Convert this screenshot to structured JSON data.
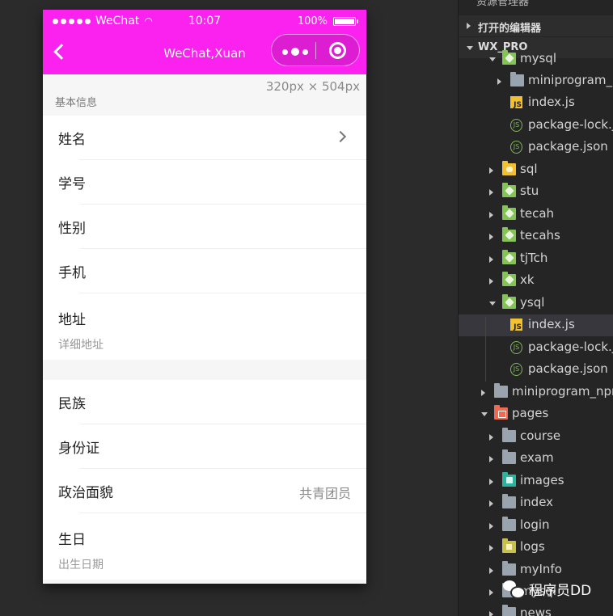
{
  "statusbar": {
    "carrier": "WeChat",
    "time": "10:07",
    "battery": "100%"
  },
  "navbar": {
    "title": "WeChat,Xuan"
  },
  "size_tag": "320px × 504px",
  "section": {
    "basic_info_title": "基本信息"
  },
  "form": {
    "group1": [
      {
        "label": "姓名"
      },
      {
        "label": "学号"
      },
      {
        "label": "性别"
      },
      {
        "label": "手机"
      },
      {
        "label": "地址",
        "placeholder": "详细地址"
      }
    ],
    "group2": [
      {
        "label": "民族"
      },
      {
        "label": "身份证"
      },
      {
        "label": "政治面貌",
        "value": "共青团员"
      },
      {
        "label": "生日",
        "placeholder": "出生日期"
      }
    ]
  },
  "explorer": {
    "top_cut": "资源管理器",
    "open_editors": "打开的编辑器",
    "project": "WX_PRO",
    "tree": [
      {
        "label": "mysql",
        "icon": "folder-green",
        "expanded": true
      },
      {
        "label": "miniprogram_npm",
        "icon": "folder"
      },
      {
        "label": "index.js",
        "icon": "js"
      },
      {
        "label": "package-lock.json",
        "icon": "json"
      },
      {
        "label": "package.json",
        "icon": "json"
      },
      {
        "label": "sql",
        "icon": "folder-yellow"
      },
      {
        "label": "stu",
        "icon": "folder-green"
      },
      {
        "label": "tecah",
        "icon": "folder-green"
      },
      {
        "label": "tecahs",
        "icon": "folder-green"
      },
      {
        "label": "tjTch",
        "icon": "folder-green"
      },
      {
        "label": "xk",
        "icon": "folder-green"
      },
      {
        "label": "ysql",
        "icon": "folder-green",
        "expanded": true
      },
      {
        "label": "index.js",
        "icon": "js",
        "selected": true
      },
      {
        "label": "package-lock.json",
        "icon": "json"
      },
      {
        "label": "package.json",
        "icon": "json"
      },
      {
        "label": "miniprogram_npm",
        "icon": "folder"
      },
      {
        "label": "pages",
        "icon": "folder-red",
        "expanded": true
      },
      {
        "label": "course",
        "icon": "folder"
      },
      {
        "label": "exam",
        "icon": "folder"
      },
      {
        "label": "images",
        "icon": "folder-teal"
      },
      {
        "label": "index",
        "icon": "folder"
      },
      {
        "label": "login",
        "icon": "folder"
      },
      {
        "label": "logs",
        "icon": "folder-olive"
      },
      {
        "label": "myInfo",
        "icon": "folder"
      },
      {
        "label": "mysql",
        "icon": "folder"
      },
      {
        "label": "news",
        "icon": "folder"
      }
    ]
  },
  "watermark": "程序员DD"
}
